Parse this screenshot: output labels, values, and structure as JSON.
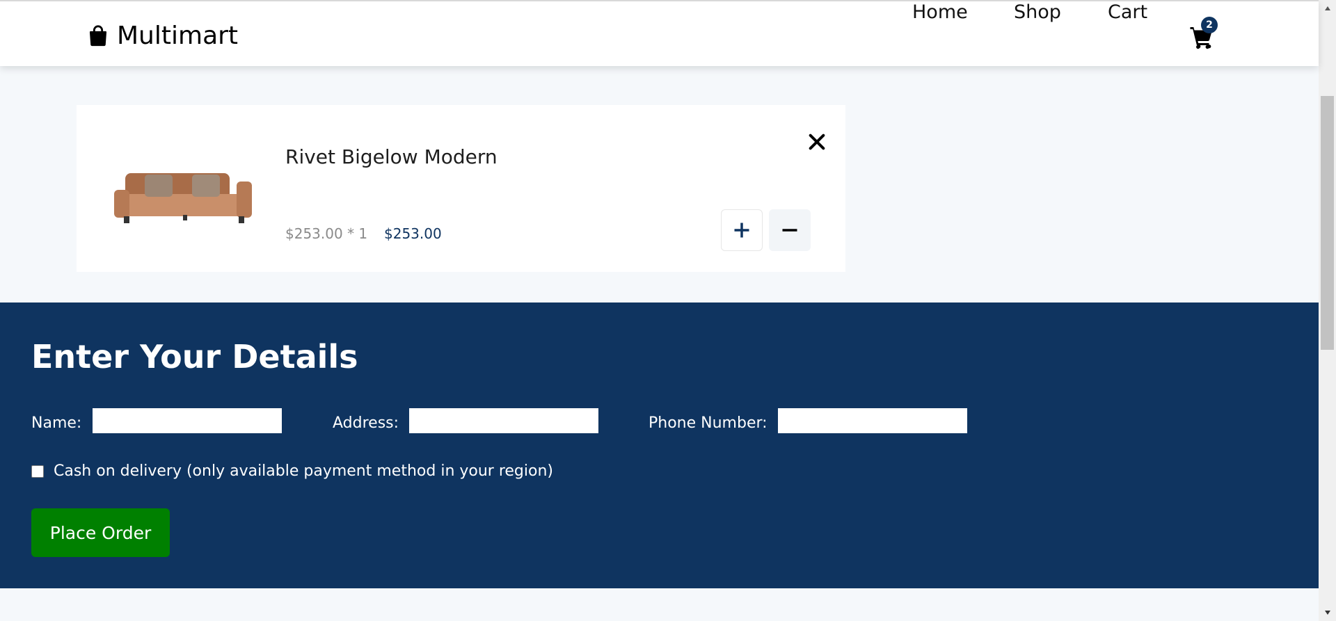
{
  "header": {
    "brand": "Multimart",
    "nav": [
      {
        "label": "Home"
      },
      {
        "label": "Shop"
      },
      {
        "label": "Cart"
      }
    ],
    "cart_count": "2"
  },
  "cart": {
    "item": {
      "name": "Rivet Bigelow Modern",
      "unit_price_qty": "$253.00 * 1",
      "total": "$253.00"
    }
  },
  "details": {
    "title": "Enter Your Details",
    "name_label": "Name:",
    "address_label": "Address:",
    "phone_label": "Phone Number:",
    "name_value": "",
    "address_value": "",
    "phone_value": "",
    "cod_label": "Cash on delivery (only available payment method in your region)",
    "place_order_label": "Place Order"
  },
  "colors": {
    "primary": "#0f3460",
    "button_green": "#008000",
    "background": "#f5f8fb"
  }
}
